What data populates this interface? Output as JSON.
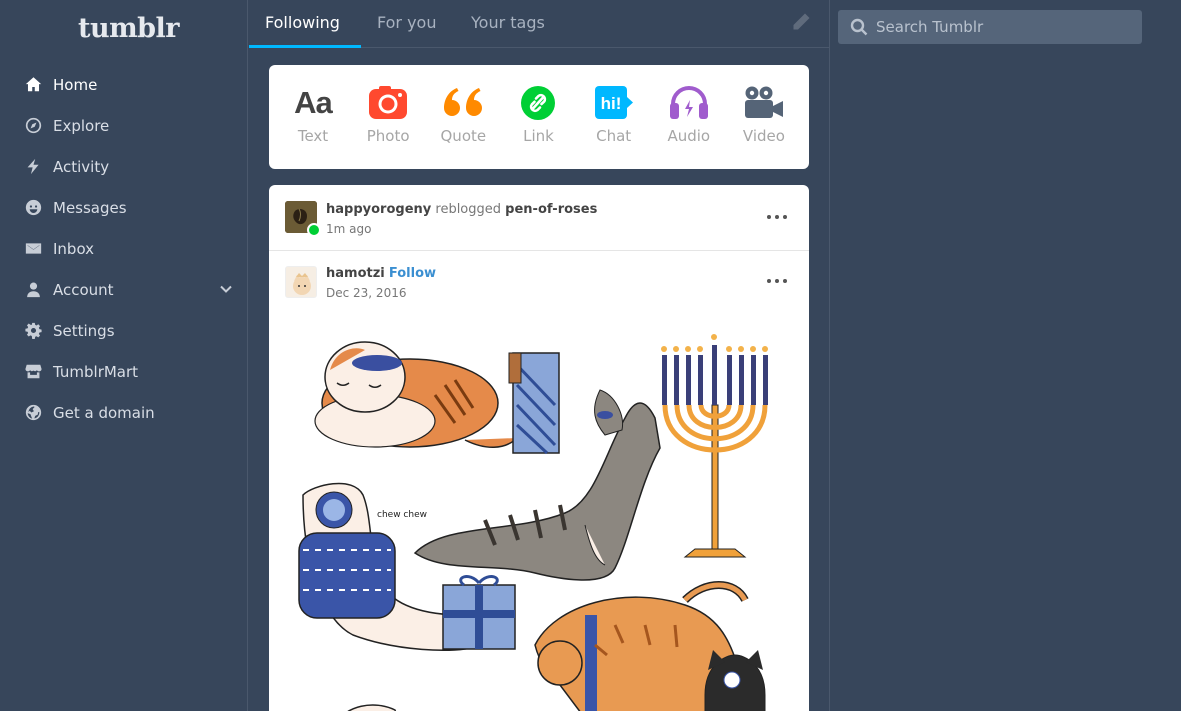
{
  "app": {
    "logo": "tumblr"
  },
  "sidebar": {
    "items": [
      {
        "label": "Home",
        "icon": "home-icon"
      },
      {
        "label": "Explore",
        "icon": "compass-icon"
      },
      {
        "label": "Activity",
        "icon": "lightning-icon"
      },
      {
        "label": "Messages",
        "icon": "smiley-icon"
      },
      {
        "label": "Inbox",
        "icon": "envelope-icon"
      },
      {
        "label": "Account",
        "icon": "person-icon"
      },
      {
        "label": "Settings",
        "icon": "gear-icon"
      },
      {
        "label": "TumblrMart",
        "icon": "storefront-icon"
      },
      {
        "label": "Get a domain",
        "icon": "globe-icon"
      }
    ]
  },
  "tabs": [
    {
      "label": "Following",
      "active": true
    },
    {
      "label": "For you",
      "active": false
    },
    {
      "label": "Your tags",
      "active": false
    }
  ],
  "search": {
    "placeholder": "Search Tumblr"
  },
  "composer": {
    "types": [
      {
        "label": "Text",
        "icon": "text-icon",
        "glyph": "Aa",
        "color": "#444444"
      },
      {
        "label": "Photo",
        "icon": "camera-icon",
        "color": "#ff492f"
      },
      {
        "label": "Quote",
        "icon": "quote-icon",
        "color": "#ff8a00"
      },
      {
        "label": "Link",
        "icon": "link-icon",
        "color": "#00cf35"
      },
      {
        "label": "Chat",
        "icon": "chat-icon",
        "glyph": "hi!",
        "color": "#00b8ff"
      },
      {
        "label": "Audio",
        "icon": "headphones-icon",
        "color": "#7c5cff"
      },
      {
        "label": "Video",
        "icon": "video-camera-icon",
        "color": "#ff62ce"
      }
    ]
  },
  "post": {
    "reblogger": "happyorogeny",
    "reblog_verb": "reblogged",
    "source": "pen-of-roses",
    "reblog_time": "1m ago",
    "author": "hamotzi",
    "follow_label": "Follow",
    "date": "Dec 23, 2016",
    "artwork_text": "chew chew"
  },
  "colors": {
    "background": "#37465b",
    "accent": "#00b8ff",
    "link": "#3b8fd1"
  }
}
